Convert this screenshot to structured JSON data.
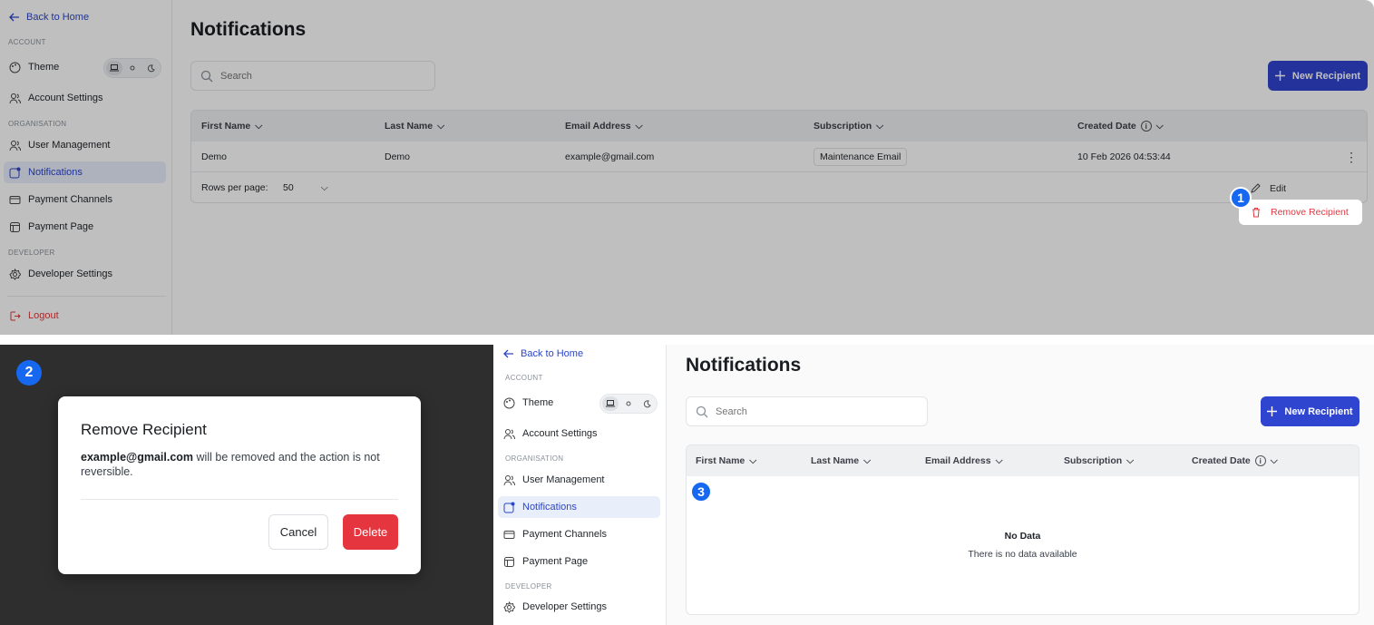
{
  "sidebar": {
    "back_label": "Back to Home",
    "section_account": "ACCOUNT",
    "section_organisation": "ORGANISATION",
    "section_developer": "DEVELOPER",
    "theme_label": "Theme",
    "account_settings": "Account Settings",
    "user_management": "User Management",
    "notifications": "Notifications",
    "payment_channels": "Payment Channels",
    "payment_page": "Payment Page",
    "developer_settings": "Developer Settings",
    "logout": "Logout"
  },
  "page": {
    "title": "Notifications",
    "search_placeholder": "Search",
    "new_recipient": "New Recipient"
  },
  "table": {
    "columns": [
      "First Name",
      "Last Name",
      "Email Address",
      "Subscription",
      "Created Date"
    ],
    "rows": [
      {
        "first_name": "Demo",
        "last_name": "Demo",
        "email": "example@gmail.com",
        "subscription": "Maintenance Email",
        "created": "10 Feb 2026 04:53:44"
      }
    ],
    "rows_per_page_label": "Rows per page:",
    "rows_per_page_value": "50",
    "empty_title": "No Data",
    "empty_subtitle": "There is no data available"
  },
  "row_menu": {
    "edit": "Edit",
    "remove": "Remove Recipient"
  },
  "dialog": {
    "title": "Remove Recipient",
    "email": "example@gmail.com",
    "message": "will be removed and the action is not reversible.",
    "cancel": "Cancel",
    "delete": "Delete"
  },
  "steps": [
    "1",
    "2",
    "3"
  ],
  "colors": {
    "accent": "#2f45cf",
    "danger": "#e5363f",
    "step_badge": "#1668f0"
  }
}
